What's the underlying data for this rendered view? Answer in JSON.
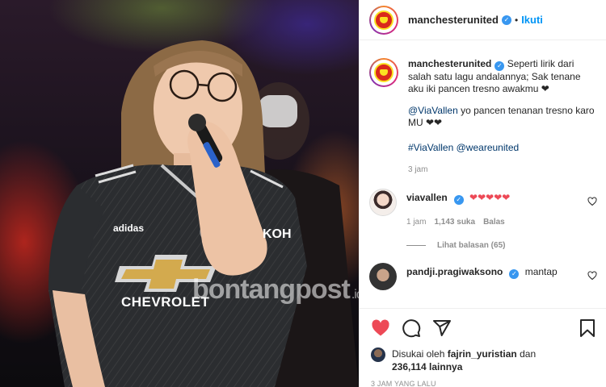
{
  "post": {
    "author": "manchesterunited",
    "follow_label": "Ikuti",
    "dot": "•",
    "watermark": "bontangpost",
    "watermark_tld": ".id",
    "jersey_sponsor": "CHEVROLET",
    "jersey_brand": "adidas",
    "jersey_sleeve": "KOH"
  },
  "caption": {
    "username": "manchesterunited",
    "text1": "Seperti lirik dari salah satu lagu andalannya; Sak tenane aku iki pancen tresno awakmu ❤",
    "mention": "@ViaVallen",
    "text2": " yo pancen tenanan tresno karo MU ❤❤",
    "hashtag1": "#ViaVallen",
    "hashtag2": "@weareunited",
    "time": "3 jam"
  },
  "comments": [
    {
      "username": "viavallen",
      "text": "❤❤❤❤❤",
      "time": "1 jam",
      "likes": "1,143 suka",
      "reply": "Balas",
      "view_replies": "Lihat balasan (65)"
    },
    {
      "username": "pandji.pragiwaksono",
      "text": "mantap"
    }
  ],
  "likes": {
    "prefix": "Disukai oleh",
    "user": "fajrin_yuristian",
    "middle": "dan",
    "count": "236,114 lainnya"
  },
  "posted_ago": "3 JAM YANG LALU",
  "icons": [
    "heart-filled-icon",
    "comment-icon",
    "share-icon",
    "bookmark-icon",
    "heart-outline-icon",
    "verified-icon"
  ],
  "colors": {
    "like_red": "#ed4956",
    "link_blue": "#0095f6",
    "verified_blue": "#3897f0",
    "mu_red": "#da291c"
  }
}
